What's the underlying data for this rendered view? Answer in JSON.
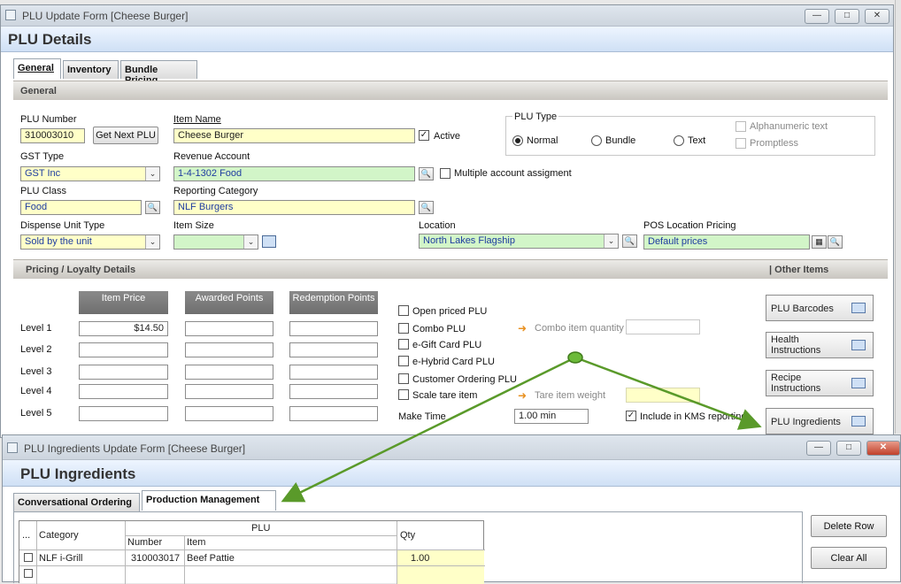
{
  "plu_window": {
    "title": "PLU Update Form [Cheese Burger]",
    "header": "PLU Details",
    "tabs": [
      "General",
      "Inventory",
      "Bundle Pricing"
    ],
    "general_section": "General",
    "plu_number_label": "PLU Number",
    "plu_number": "310003010",
    "get_next_plu": "Get Next PLU",
    "item_name_label": "Item Name",
    "item_name": "Cheese Burger",
    "active_label": "Active",
    "plu_type_label": "PLU Type",
    "plu_type_options": [
      "Normal",
      "Bundle",
      "Text"
    ],
    "alphanumeric_label": "Alphanumeric text",
    "promptless_label": "Promptless",
    "gst_type_label": "GST Type",
    "gst_type": "GST Inc",
    "revenue_account_label": "Revenue Account",
    "revenue_account": "1-4-1302  Food",
    "multiple_account_label": "Multiple account assigment",
    "plu_class_label": "PLU Class",
    "plu_class": "Food",
    "reporting_category_label": "Reporting Category",
    "reporting_category": "NLF Burgers",
    "dispense_unit_label": "Dispense Unit Type",
    "dispense_unit": "Sold by the unit",
    "item_size_label": "Item Size",
    "location_label": "Location",
    "location": "North Lakes Flagship",
    "pos_location_label": "POS Location Pricing",
    "pos_location": "Default prices",
    "pricing_section": "Pricing / Loyalty Details",
    "other_items_section": "| Other Items",
    "price_columns": [
      "Item Price",
      "Awarded Points",
      "Redemption Points"
    ],
    "levels": [
      {
        "label": "Level 1",
        "price": "$14.50"
      },
      {
        "label": "Level 2",
        "price": ""
      },
      {
        "label": "Level 3",
        "price": ""
      },
      {
        "label": "Level 4",
        "price": ""
      },
      {
        "label": "Level 5",
        "price": ""
      }
    ],
    "checkboxes": [
      "Open priced PLU",
      "Combo PLU",
      "e-Gift Card PLU",
      "e-Hybrid Card PLU",
      "Customer Ordering PLU",
      "Scale tare item"
    ],
    "combo_qty_label": "Combo item quantity",
    "tare_weight_label": "Tare item weight",
    "make_time_label": "Make Time",
    "make_time": "1.00 min",
    "kms_label": "Include in KMS reporting",
    "side_buttons": [
      "PLU Barcodes",
      "Health Instructions",
      "Recipe Instructions",
      "PLU Ingredients"
    ]
  },
  "ingredients_window": {
    "title": "PLU Ingredients Update Form [Cheese Burger]",
    "header": "PLU Ingredients",
    "tabs": [
      "Conversational Ordering",
      "Production Management"
    ],
    "grid": {
      "dots": "...",
      "category_header": "Category",
      "plu_header": "PLU",
      "number_header": "Number",
      "item_header": "Item",
      "qty_header": "Qty",
      "rows": [
        {
          "category": "NLF i-Grill",
          "number": "310003017",
          "item": "Beef Pattie",
          "qty": "1.00"
        }
      ]
    },
    "delete_row": "Delete Row",
    "clear_all": "Clear All"
  },
  "colors": {
    "accent_arrow": "#5a9a2a",
    "yellow_field": "#ffffc8",
    "green_field": "#d2f5c8"
  }
}
